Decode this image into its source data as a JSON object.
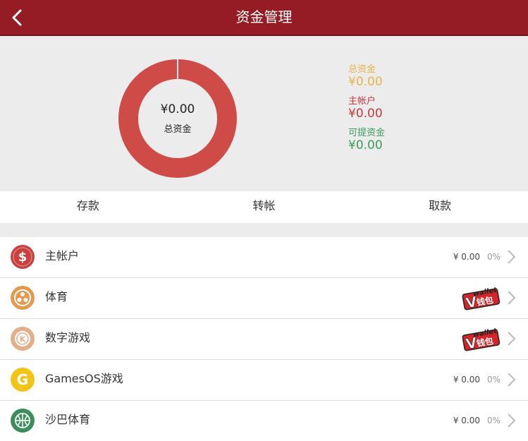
{
  "header": {
    "title": "资金管理"
  },
  "summary": {
    "donut": {
      "amount": "¥0.00",
      "label": "总资金"
    },
    "legend": [
      {
        "label": "总资金",
        "value": "¥0.00",
        "color": "#e8b446"
      },
      {
        "label": "主帐户",
        "value": "¥0.00",
        "color": "#c6393e"
      },
      {
        "label": "可提资金",
        "value": "¥0.00",
        "color": "#3a9d5a"
      }
    ]
  },
  "actions": [
    {
      "label": "存款"
    },
    {
      "label": "转帐"
    },
    {
      "label": "取款"
    }
  ],
  "wallets": [
    {
      "name": "主帐户",
      "icon": "dollar-icon",
      "balance": "¥ 0.00",
      "percent": "0%"
    },
    {
      "name": "体育",
      "icon": "sports-icon",
      "badge_text": "wallet",
      "badge_cn": "钱包"
    },
    {
      "name": "数字游戏",
      "icon": "digital-game-icon",
      "badge_text": "wallet",
      "badge_cn": "钱包"
    },
    {
      "name": "GamesOS游戏",
      "icon": "gamesos-icon",
      "balance": "¥ 0.00",
      "percent": "0%"
    },
    {
      "name": "沙巴体育",
      "icon": "basketball-icon",
      "balance": "¥ 0.00",
      "percent": "0%"
    }
  ],
  "colors": {
    "header": "#951c24",
    "donut": "#ce4b48",
    "dollar_icon": "#c9403f",
    "sports_icon": "#e39a4c",
    "digital_game_icon": "#e6ad87",
    "gamesos_icon": "#f0c419",
    "basketball_icon": "#3c8d5c"
  }
}
